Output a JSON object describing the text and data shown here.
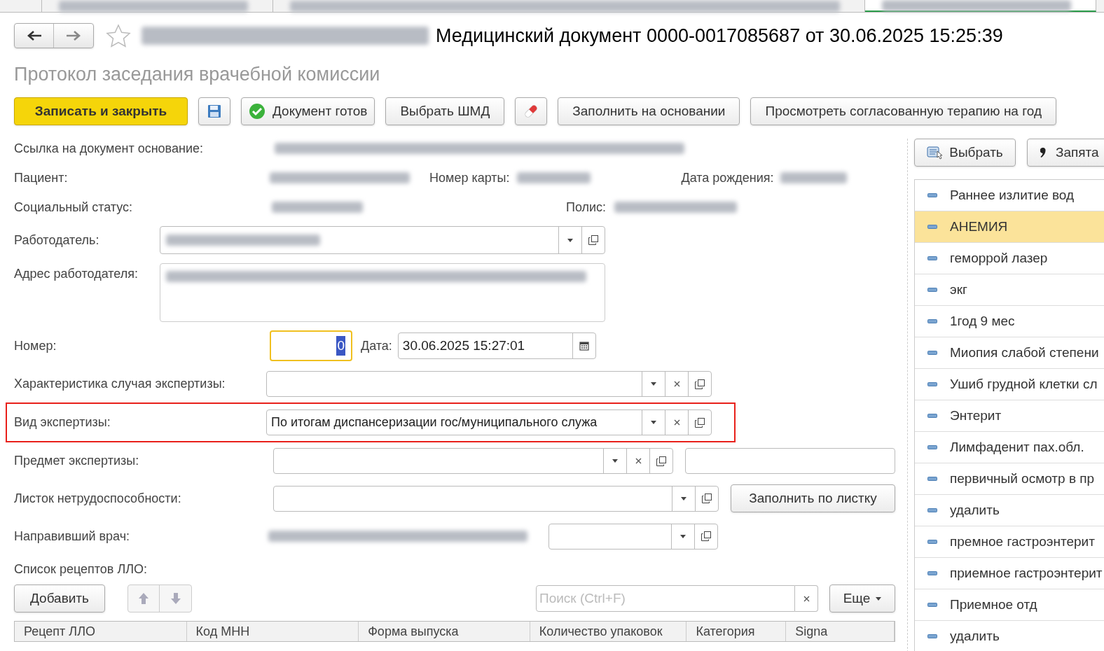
{
  "tabs": [
    {
      "selected": false
    },
    {
      "selected": false
    },
    {
      "selected": false
    },
    {
      "selected": true
    }
  ],
  "header": {
    "title": "Медицинский документ 0000-0017085687 от 30.06.2025 15:25:39",
    "subtitle": "Протокол заседания врачебной комиссии",
    "favorite": false
  },
  "toolbar": [
    {
      "kind": "primary",
      "label": "Записать и закрыть"
    },
    {
      "kind": "save"
    },
    {
      "kind": "ready",
      "label": "Документ готов"
    },
    {
      "kind": "plain",
      "label": "Выбрать ШМД"
    },
    {
      "kind": "pill"
    },
    {
      "kind": "plain",
      "label": "Заполнить на основании"
    },
    {
      "kind": "plain",
      "label": "Просмотреть согласованную терапию на год"
    }
  ],
  "info": {
    "link_label": "Ссылка на документ основание:",
    "patient_label": "Пациент:",
    "card_label": "Номер карты:",
    "birth_label": "Дата рождения:",
    "social_label": "Социальный статус:",
    "policy_label": "Полис:"
  },
  "employer": {
    "label": "Работодатель:"
  },
  "employer_address": {
    "label": "Адрес работодателя:"
  },
  "number": {
    "label": "Номер:",
    "value": "0",
    "focused": true,
    "date_label": "Дата:",
    "date_value": "30.06.2025 15:27:01"
  },
  "fields": [
    {
      "label": "Характеристика случая экспертизы:",
      "clear": true,
      "highlighted": false
    },
    {
      "label": "Вид экспертизы:",
      "value": "По итогам диспансеризации гос/муниципального служа",
      "clear": true,
      "highlighted": true
    }
  ],
  "subject": {
    "label": "Предмет экспертизы:"
  },
  "sick_leave": {
    "label": "Листок нетрудоспособности:",
    "button": "Заполнить по листку"
  },
  "doctor": {
    "label": "Направивший врач:"
  },
  "prescriptions": {
    "label": "Список рецептов ЛЛО:",
    "add_button": "Добавить",
    "search_placeholder": "Поиск (Ctrl+F)",
    "more_button": "Еще",
    "columns": [
      "Рецепт ЛЛО",
      "Код МНН",
      "Форма выпуска",
      "Количество упаковок",
      "Категория",
      "Signa"
    ]
  },
  "side": {
    "select_button": "Выбрать",
    "comma_button": "Запята",
    "items": [
      {
        "label": "Раннее излитие вод",
        "selected": false
      },
      {
        "label": "АНЕМИЯ",
        "selected": true
      },
      {
        "label": "геморрой лазер",
        "selected": false
      },
      {
        "label": "экг",
        "selected": false
      },
      {
        "label": "1год 9 мес",
        "selected": false
      },
      {
        "label": "Миопия слабой степени",
        "selected": false
      },
      {
        "label": "Ушиб грудной клетки сл",
        "selected": false
      },
      {
        "label": "Энтерит",
        "selected": false
      },
      {
        "label": "Лимфаденит пах.обл.",
        "selected": false
      },
      {
        "label": "первичный осмотр в пр",
        "selected": false
      },
      {
        "label": "удалить",
        "selected": false
      },
      {
        "label": "премное гастроэнтерит",
        "selected": false
      },
      {
        "label": "приемное гастроэнтерит",
        "selected": false
      },
      {
        "label": "Приемное отд",
        "selected": false
      },
      {
        "label": "удалить",
        "selected": false
      }
    ]
  }
}
